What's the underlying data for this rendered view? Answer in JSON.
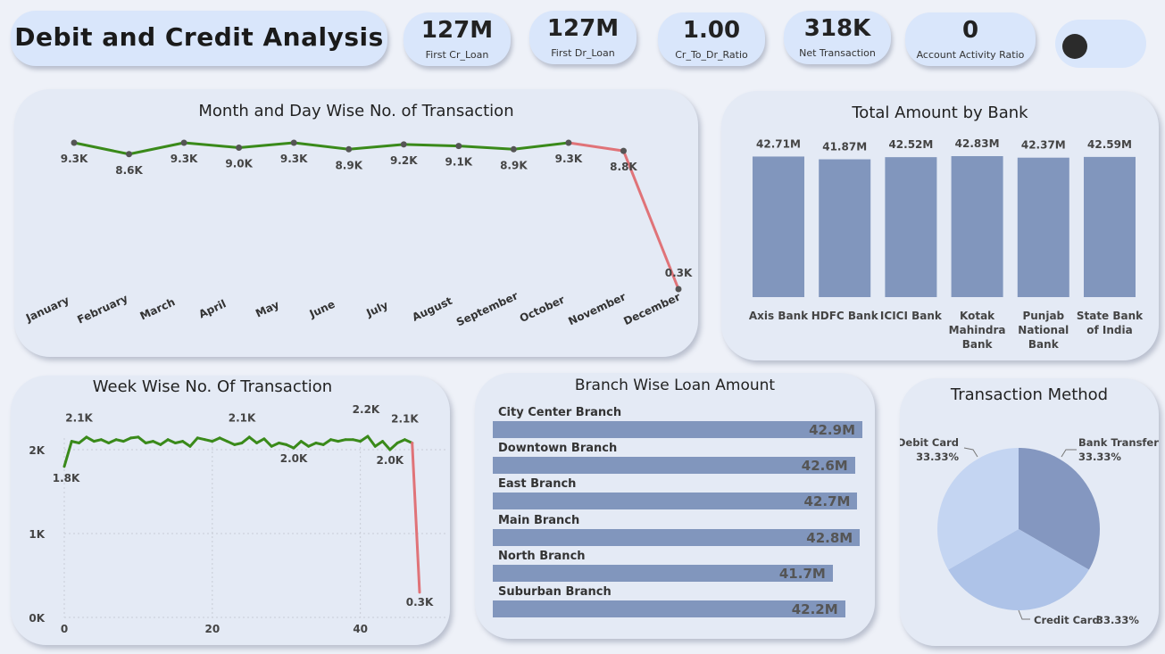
{
  "header": {
    "title": "Debit and Credit Analysis"
  },
  "kpis": [
    {
      "value": "127M",
      "label": "First Cr_Loan"
    },
    {
      "value": "127M",
      "label": "First Dr_Loan"
    },
    {
      "value": "1.00",
      "label": "Cr_To_Dr_Ratio"
    },
    {
      "value": "318K",
      "label": "Net Transaction"
    },
    {
      "value": "0",
      "label": "Account Activity Ratio"
    }
  ],
  "colors": {
    "line_green": "#3a8a1a",
    "line_red": "#e07378",
    "bar": "#8196bd",
    "pie_bank_transfer": "#8497c0",
    "pie_credit_card": "#aec3e8",
    "pie_debit_card": "#c4d5f2"
  },
  "chart_data": [
    {
      "type": "line",
      "title": "Month and Day Wise No. of Transaction",
      "categories": [
        "January",
        "February",
        "March",
        "April",
        "May",
        "June",
        "July",
        "August",
        "September",
        "October",
        "November",
        "December"
      ],
      "values": [
        9.3,
        8.6,
        9.3,
        9.0,
        9.3,
        8.9,
        9.2,
        9.1,
        8.9,
        9.3,
        8.8,
        0.3
      ],
      "labels": [
        "9.3K",
        "8.6K",
        "9.3K",
        "9.0K",
        "9.3K",
        "8.9K",
        "9.2K",
        "9.1K",
        "8.9K",
        "9.3K",
        "8.8K",
        "0.3K"
      ],
      "unit": "K"
    },
    {
      "type": "bar",
      "title": "Total Amount by Bank",
      "categories": [
        "Axis Bank",
        "HDFC Bank",
        "ICICI Bank",
        "Kotak Mahindra Bank",
        "Punjab National Bank",
        "State Bank of India"
      ],
      "values": [
        42.71,
        41.87,
        42.52,
        42.83,
        42.37,
        42.59
      ],
      "labels": [
        "42.71M",
        "41.87M",
        "42.52M",
        "42.83M",
        "42.37M",
        "42.59M"
      ]
    },
    {
      "type": "line",
      "title": "Week Wise No. Of Transaction",
      "x": [
        0,
        1,
        2,
        3,
        4,
        5,
        6,
        7,
        8,
        9,
        10,
        11,
        12,
        13,
        14,
        15,
        16,
        17,
        18,
        19,
        20,
        21,
        22,
        23,
        24,
        25,
        26,
        27,
        28,
        29,
        30,
        31,
        32,
        33,
        34,
        35,
        36,
        37,
        38,
        39,
        40,
        41,
        42,
        43,
        44,
        45,
        46,
        47,
        48
      ],
      "values": [
        1.8,
        2.1,
        2.08,
        2.15,
        2.1,
        2.12,
        2.08,
        2.12,
        2.1,
        2.14,
        2.15,
        2.08,
        2.1,
        2.06,
        2.12,
        2.08,
        2.1,
        2.04,
        2.14,
        2.12,
        2.1,
        2.14,
        2.1,
        2.06,
        2.08,
        2.15,
        2.08,
        2.13,
        2.04,
        2.08,
        2.06,
        2.02,
        2.1,
        2.04,
        2.08,
        2.06,
        2.12,
        2.1,
        2.12,
        2.12,
        2.1,
        2.16,
        2.04,
        2.1,
        2.0,
        2.08,
        2.12,
        2.08,
        0.3
      ],
      "annotations": [
        "1.8K",
        "2.1K",
        "2.1K",
        "2.0K",
        "2.2K",
        "2.0K",
        "2.1K",
        "0.3K"
      ],
      "yticks": [
        "0K",
        "1K",
        "2K"
      ],
      "xticks": [
        "0",
        "20",
        "40"
      ],
      "ylim": [
        0,
        2.3
      ],
      "xlim": [
        0,
        48
      ],
      "grid": true
    },
    {
      "type": "bar",
      "orientation": "horizontal",
      "title": "Branch Wise Loan Amount",
      "categories": [
        "City Center Branch",
        "Downtown Branch",
        "East Branch",
        "Main Branch",
        "North Branch",
        "Suburban Branch"
      ],
      "values": [
        42.9,
        42.6,
        42.7,
        42.8,
        41.7,
        42.2
      ],
      "labels": [
        "42.9M",
        "42.6M",
        "42.7M",
        "42.8M",
        "41.7M",
        "42.2M"
      ]
    },
    {
      "type": "pie",
      "title": "Transaction Method",
      "slices": [
        {
          "name": "Bank Transfer",
          "value": 33.33,
          "label": "33.33%"
        },
        {
          "name": "Credit Card",
          "value": 33.33,
          "label": "33.33%"
        },
        {
          "name": "Debit Card",
          "value": 33.33,
          "label": "33.33%"
        }
      ]
    }
  ]
}
